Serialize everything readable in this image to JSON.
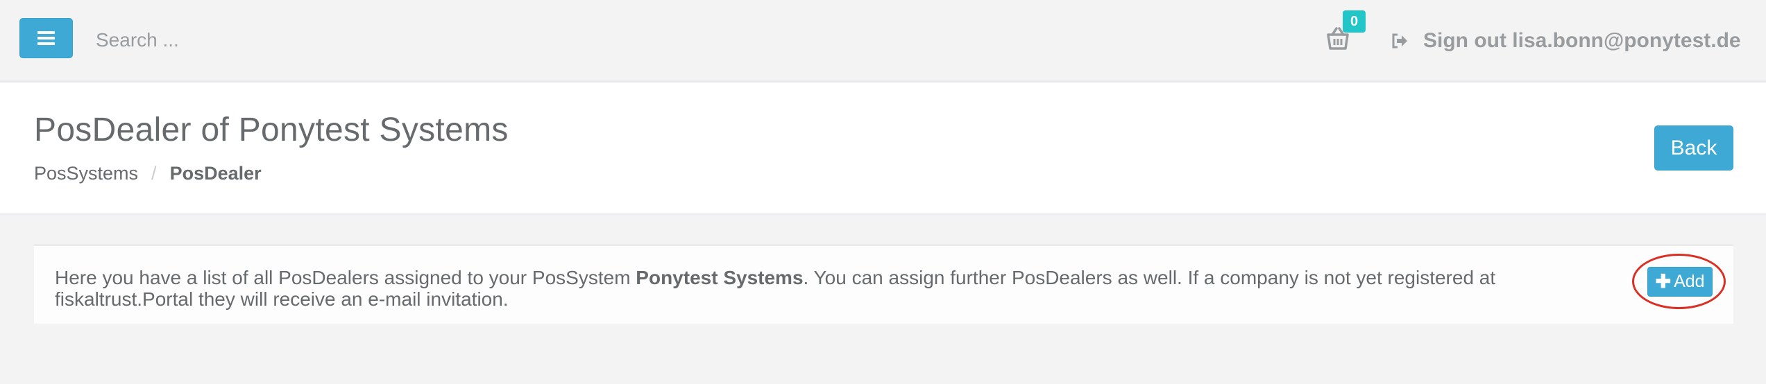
{
  "topbar": {
    "menu_icon": "hamburger-icon",
    "search_placeholder": "Search ...",
    "cart_icon": "basket-icon",
    "cart_count": "0",
    "signout_icon": "sign-out-icon",
    "signout_label": "Sign out lisa.bonn@ponytest.de"
  },
  "heading": {
    "title": "PosDealer of Ponytest Systems",
    "breadcrumb": [
      {
        "label": "PosSystems"
      },
      {
        "label": "PosDealer"
      }
    ],
    "breadcrumb_separator": "/",
    "back_label": "Back"
  },
  "info": {
    "text_before": "Here you have a list of all PosDealers assigned to your PosSystem ",
    "system_name": "Ponytest Systems",
    "text_after": ". You can assign further PosDealers as well. If a company is not yet registered at fiskaltrust.Portal they will receive an e-mail invitation.",
    "add_icon": "plus-icon",
    "add_label": "Add"
  },
  "colors": {
    "primary": "#3fa9d6",
    "badge": "#23c6c8",
    "highlight": "#d93025"
  }
}
